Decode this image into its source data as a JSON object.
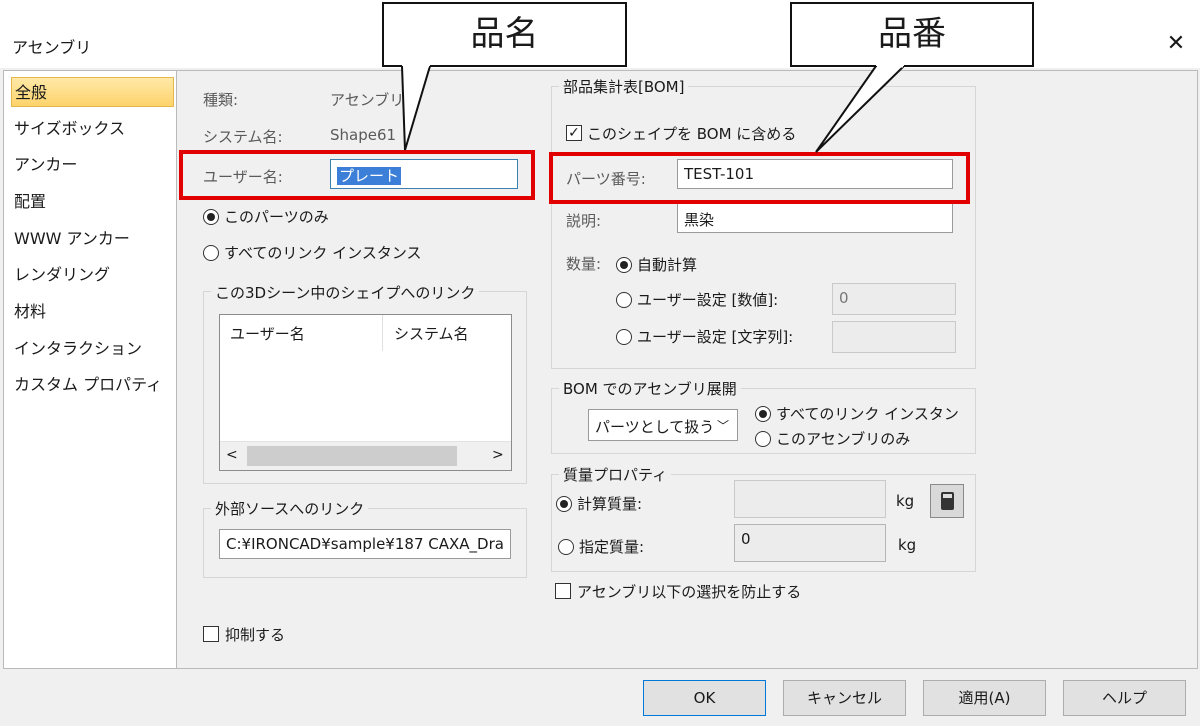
{
  "window": {
    "title": "アセンブリ",
    "close_glyph": "✕"
  },
  "callouts": {
    "name": "品名",
    "number": "品番"
  },
  "sidebar": {
    "items": [
      {
        "label": "全般"
      },
      {
        "label": "サイズボックス"
      },
      {
        "label": "アンカー"
      },
      {
        "label": "配置"
      },
      {
        "label": "WWW アンカー"
      },
      {
        "label": "レンダリング"
      },
      {
        "label": "材料"
      },
      {
        "label": "インタラクション"
      },
      {
        "label": "カスタム プロパティ"
      }
    ]
  },
  "general": {
    "type_label": "種類:",
    "type_value": "アセンブリ",
    "system_name_label": "システム名:",
    "system_name_value": "Shape61",
    "user_name_label": "ユーザー名:",
    "user_name_value": "プレート",
    "radio_this_part": "このパーツのみ",
    "radio_all_links": "すべてのリンク インスタンス",
    "links_group_title": "この3Dシーン中のシェイプへのリンク",
    "links_columns": [
      "ユーザー名",
      "システム名"
    ],
    "external_group_title": "外部ソースへのリンク",
    "external_value": "C:¥IRONCAD¥sample¥187 CAXA_Dra",
    "suppress_label": "抑制する"
  },
  "bom": {
    "group_title": "部品集計表[BOM]",
    "include_label": "このシェイプを BOM に含める",
    "part_number_label": "パーツ番号:",
    "part_number_value": "TEST-101",
    "description_label": "説明:",
    "description_value": "黒染",
    "quantity_label": "数量:",
    "qty_auto": "自動計算",
    "qty_user_number": "ユーザー設定 [数値]:",
    "qty_user_number_value": "0",
    "qty_user_text": "ユーザー設定 [文字列]:",
    "qty_user_text_value": ""
  },
  "bom_expand": {
    "group_title": "BOM でのアセンブリ展開",
    "select_value": "パーツとして扱う",
    "radio_all_instances": "すべてのリンク インスタン",
    "radio_this_assembly": "このアセンブリのみ"
  },
  "mass": {
    "group_title": "質量プロパティ",
    "calc_label": "計算質量:",
    "calc_value": "",
    "calc_unit": "kg",
    "spec_label": "指定質量:",
    "spec_value": "0",
    "spec_unit": "kg"
  },
  "prevent_label": "アセンブリ以下の選択を防止する",
  "buttons": {
    "ok": "OK",
    "cancel": "キャンセル",
    "apply": "適用(A)",
    "help": "ヘルプ"
  }
}
